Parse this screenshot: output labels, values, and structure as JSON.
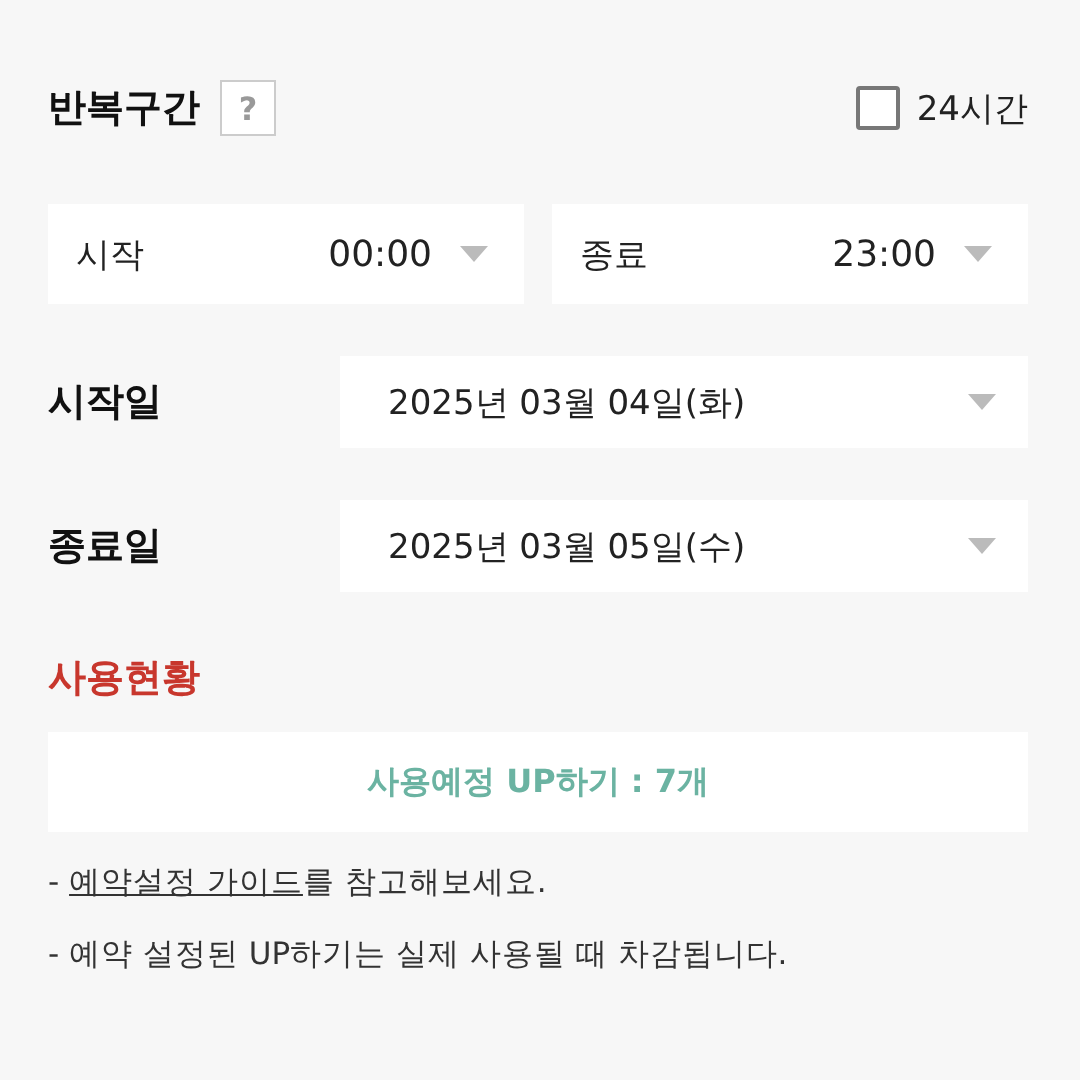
{
  "header": {
    "title": "반복구간",
    "help": "?",
    "all_day": {
      "label": "24시간",
      "checked": false
    }
  },
  "times": [
    {
      "label": "시작",
      "value": "00:00"
    },
    {
      "label": "종료",
      "value": "23:00"
    }
  ],
  "dates": [
    {
      "label": "시작일",
      "value": "2025년 03월 04일(화)"
    },
    {
      "label": "종료일",
      "value": "2025년 03월 05일(수)"
    }
  ],
  "usage": {
    "title": "사용현황",
    "summary": "사용예정 UP하기 : 7개"
  },
  "notes": [
    {
      "kind": "link",
      "prefix": "- ",
      "link": "예약설정 가이드",
      "suffix": "를 참고해보세요."
    },
    {
      "kind": "plain",
      "text": "- 예약 설정된 UP하기는 실제 사용될 때 차감됩니다."
    }
  ]
}
